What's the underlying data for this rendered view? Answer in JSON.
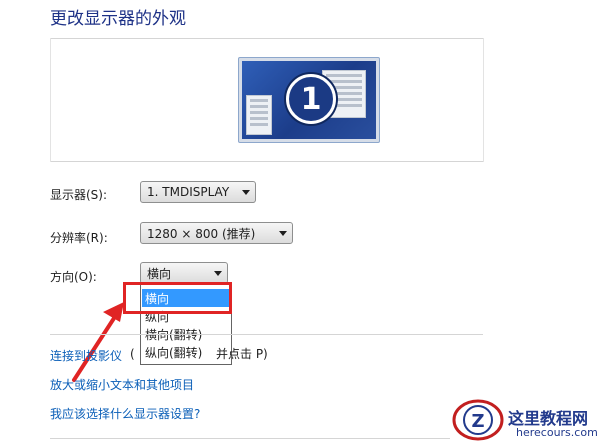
{
  "page": {
    "title": "更改显示器的外观"
  },
  "monitor_preview": {
    "number": "1"
  },
  "settings": {
    "display": {
      "label": "显示器(S):",
      "value": "1. TMDISPLAY"
    },
    "resolution": {
      "label": "分辨率(R):",
      "value": "1280 × 800 (推荐)"
    },
    "orientation": {
      "label": "方向(O):",
      "value": "横向",
      "options": [
        "横向",
        "纵向",
        "横向(翻转)",
        "纵向(翻转)"
      ],
      "selected_index": 0
    }
  },
  "links": {
    "projector_link": "连接到投影仪",
    "projector_hint_start": "(",
    "projector_hint_end": "并点击 P)",
    "text_size_link": "放大或缩小文本和其他项目",
    "which_settings_link": "我应该选择什么显示器设置?"
  },
  "watermark": {
    "logo_letter": "Z",
    "site_title": "这里教程网",
    "site_url": "herecours.com"
  },
  "colors": {
    "title": "#1e3287",
    "link": "#0b5fb8",
    "highlight": "#e02424",
    "selected_option_bg": "#3399ff"
  }
}
